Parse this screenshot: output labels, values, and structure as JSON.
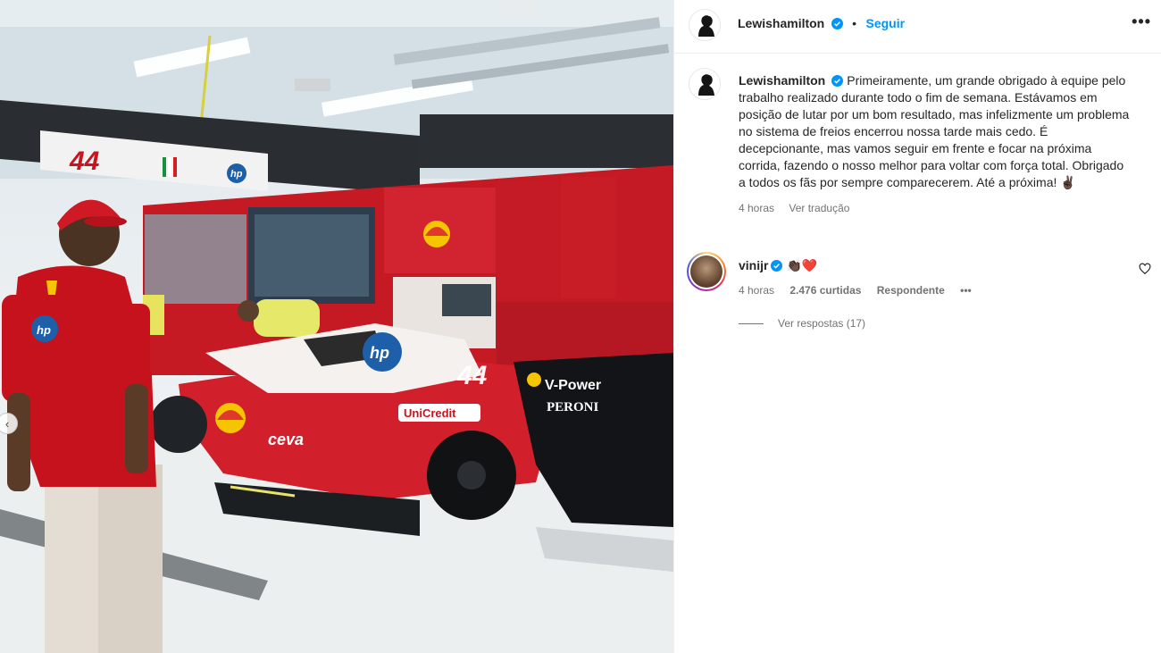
{
  "post": {
    "author": {
      "username": "Lewishamilton",
      "verified": true,
      "follow_label": "Seguir",
      "separator": "•"
    },
    "more_label": "•••",
    "caption": {
      "username": "Lewishamilton",
      "text": "Primeiramente, um grande obrigado à equipe pelo trabalho realizado durante todo o fim de semana. Estávamos em posição de lutar por um bom resultado, mas infelizmente um problema no sistema de freios encerrou nossa tarde mais cedo. É decepcionante, mas vamos seguir em frente e focar na próxima corrida, fazendo o nosso melhor para voltar com força total. Obrigado a todos os fãs por sempre comparecerem. Até a próxima! ✌🏿",
      "time": "4 horas",
      "translate_label": "Ver tradução"
    },
    "comments": [
      {
        "username": "vinijr",
        "verified": true,
        "text": "👏🏿❤️",
        "time": "4 horas",
        "likes": "2.476 curtidas",
        "reply_label": "Respondente",
        "options_label": "•••",
        "replies_label": "Ver respostas (17)"
      }
    ],
    "image": {
      "description_icon": "photo",
      "car_number": "44",
      "sponsor_brands": [
        "hp",
        "Shell",
        "UniCredit",
        "CEVA",
        "V-Power",
        "PERONI"
      ]
    }
  },
  "colors": {
    "accent": "#0095f6",
    "text": "#262626",
    "muted": "#737373",
    "ferrari_red": "#c8141e"
  }
}
